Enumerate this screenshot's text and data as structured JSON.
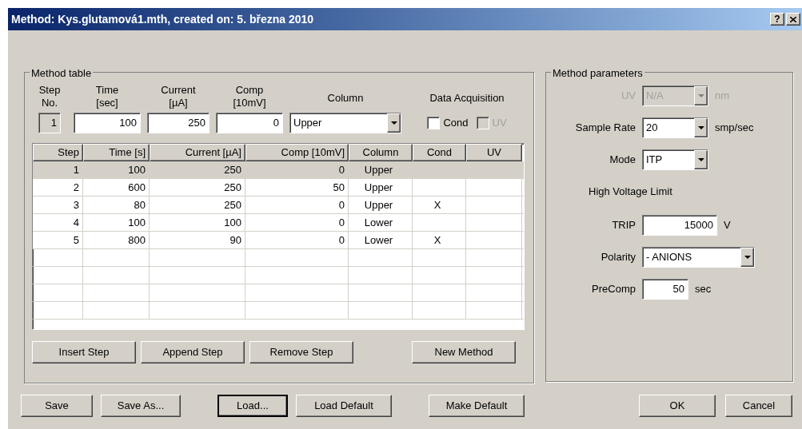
{
  "window": {
    "title": "Method: Kys.glutamová1.mth, created on: 5. března 2010",
    "help": "?"
  },
  "method_table": {
    "title": "Method table",
    "editor": {
      "headers": [
        [
          "Step",
          "No."
        ],
        [
          "Time",
          "[sec]"
        ],
        [
          "Current",
          "[µA]"
        ],
        [
          "Comp",
          "[10mV]"
        ]
      ],
      "column_label": "Column",
      "acquisition_label": "Data Acquisition",
      "step_no": {
        "value": "1",
        "disabled": true
      },
      "fields": [
        "100",
        "250",
        "0"
      ],
      "column": "Upper",
      "checks": [
        {
          "label": "Cond",
          "checked": false,
          "disabled": false
        },
        {
          "label": "UV",
          "checked": false,
          "disabled": true
        }
      ]
    },
    "table": {
      "columns": [
        "Step",
        "Time [s]",
        "Current [µA]",
        "Comp [10mV]",
        "Column",
        "Cond",
        "UV"
      ],
      "rows": [
        {
          "selected": true,
          "cells": [
            "1",
            "100",
            "250",
            "0",
            "Upper",
            "",
            ""
          ]
        },
        {
          "selected": false,
          "cells": [
            "2",
            "600",
            "250",
            "50",
            "Upper",
            "",
            ""
          ]
        },
        {
          "selected": false,
          "cells": [
            "3",
            "80",
            "250",
            "0",
            "Upper",
            "X",
            ""
          ]
        },
        {
          "selected": false,
          "cells": [
            "4",
            "100",
            "100",
            "0",
            "Lower",
            "",
            ""
          ]
        },
        {
          "selected": false,
          "cells": [
            "5",
            "800",
            "90",
            "0",
            "Lower",
            "X",
            ""
          ]
        }
      ]
    },
    "buttons": [
      "Insert Step",
      "Append Step",
      "Remove Step",
      "New Method"
    ]
  },
  "method_parameters": {
    "title": "Method parameters",
    "uv": {
      "label": "UV",
      "value": "N/A",
      "unit": "nm",
      "disabled": true
    },
    "sample_rate": {
      "label": "Sample Rate",
      "value": "20",
      "unit": "smp/sec"
    },
    "mode": {
      "label": "Mode",
      "value": "ITP"
    },
    "heading": "High Voltage Limit",
    "trip": {
      "label": "TRIP",
      "value": "15000",
      "unit": "V"
    },
    "polarity": {
      "label": "Polarity",
      "value": "- ANIONS"
    },
    "precomp": {
      "label": "PreComp",
      "value": "50",
      "unit": "sec"
    }
  },
  "buttons": [
    {
      "label": "Save",
      "default": false
    },
    {
      "label": "Save As...",
      "default": false
    },
    {
      "label": "Load...",
      "default": true
    },
    {
      "label": "Load Default",
      "default": false
    },
    {
      "label": "Make Default",
      "default": false
    },
    {
      "label": "OK",
      "default": false
    },
    {
      "label": "Cancel",
      "default": false
    }
  ]
}
